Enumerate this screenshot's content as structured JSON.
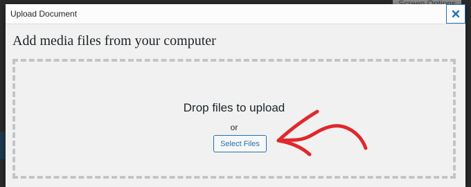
{
  "background": {
    "screen_options_label": "Screen Options"
  },
  "modal": {
    "title": "Upload Document",
    "close_icon": "close-icon",
    "heading": "Add media files from your computer",
    "drop_zone": {
      "drop_text": "Drop files to upload",
      "or_text": "or",
      "select_button_label": "Select Files"
    }
  },
  "annotation": {
    "icon": "red-arrow-icon",
    "color": "#e0282d"
  },
  "colors": {
    "accent": "#2271b1",
    "modal_background": "#f1f1f1",
    "dashed_border": "#c3c4c7"
  }
}
